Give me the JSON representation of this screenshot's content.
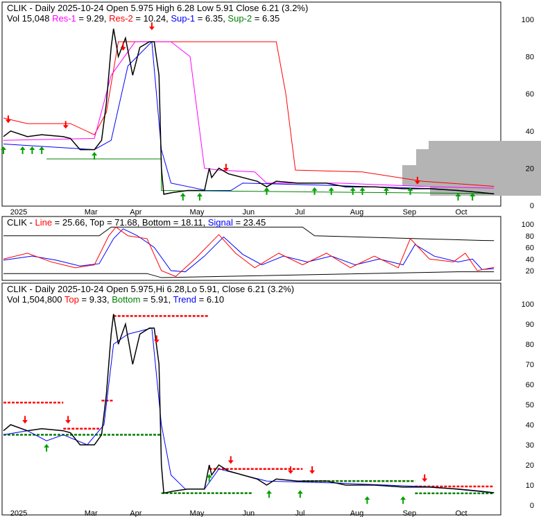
{
  "colors": {
    "res1": "#ff00ff",
    "res2": "#ff0000",
    "sup1": "#0000ff",
    "sup2": "#008000",
    "up": "#00a000",
    "down": "#ff0000"
  },
  "top_header": {
    "line1": "CLIK - Daily 2025-10-24 Open 5.975  High 6.28  Low 5.91  Close 6.21 (3.2%)",
    "vol": "Vol 15,048",
    "res1_label": "Res-1",
    "res1_val": " = 9.29, ",
    "res2_label": "Res-2",
    "res2_val": " = 10.24, ",
    "sup1_label": "Sup-1",
    "sup1_val": " = 6.35, ",
    "sup2_label": "Sup-2",
    "sup2_val": " = 6.35"
  },
  "mid_header": {
    "prefix": "CLIK - ",
    "line_label": "Line",
    "line_val": " = 25.66, Top = 71.68, Bottom = 18.11, ",
    "signal_label": "Signal",
    "signal_val": " = 23.45"
  },
  "bot_header": {
    "line1": "CLIK - Daily 2025-10-24 Open 5.975,Hi 6.28,Lo 5.91, Close 6.21 (3.2%)",
    "vol": "Vol 1,504,800 ",
    "top_label": "Top",
    "top_val": " = 9.33, ",
    "bottom_label": "Bottom",
    "bottom_val": " = 5.91, ",
    "trend_label": "Trend",
    "trend_val": " = 6.10"
  },
  "chart_data": [
    {
      "type": "line",
      "title": "CLIK - Daily price with support/resistance",
      "ylim": [
        0,
        100
      ],
      "yticks": [
        0,
        20,
        40,
        60,
        80,
        100
      ],
      "x_ticks": [
        {
          "label": "2025",
          "day": 4
        },
        {
          "label": "Mar",
          "day": 35
        },
        {
          "label": "Apr",
          "day": 54
        },
        {
          "label": "May",
          "day": 79
        },
        {
          "label": "Jun",
          "day": 101
        },
        {
          "label": "Jul",
          "day": 123
        },
        {
          "label": "Aug",
          "day": 146
        },
        {
          "label": "Sep",
          "day": 168
        },
        {
          "label": "Oct",
          "day": 190
        }
      ],
      "price": [
        [
          0,
          37
        ],
        [
          3,
          40
        ],
        [
          10,
          37
        ],
        [
          16,
          38
        ],
        [
          25,
          37
        ],
        [
          28,
          36
        ],
        [
          32,
          30
        ],
        [
          38,
          30
        ],
        [
          41,
          35
        ],
        [
          43,
          55
        ],
        [
          45,
          85
        ],
        [
          46,
          95
        ],
        [
          48,
          80
        ],
        [
          51,
          90
        ],
        [
          54,
          70
        ],
        [
          57,
          85
        ],
        [
          61,
          88
        ],
        [
          63,
          88
        ],
        [
          65,
          70
        ],
        [
          66,
          20
        ],
        [
          67,
          6
        ],
        [
          71,
          7
        ],
        [
          77,
          8
        ],
        [
          84,
          8
        ],
        [
          86,
          20
        ],
        [
          87,
          15
        ],
        [
          90,
          20
        ],
        [
          94,
          17
        ],
        [
          100,
          15
        ],
        [
          106,
          13
        ],
        [
          110,
          10
        ],
        [
          114,
          13
        ],
        [
          123,
          12
        ],
        [
          135,
          12
        ],
        [
          143,
          10
        ],
        [
          155,
          10
        ],
        [
          167,
          9
        ],
        [
          178,
          9
        ],
        [
          190,
          8
        ],
        [
          199,
          7
        ],
        [
          205,
          6.21
        ]
      ],
      "res2": [
        [
          0,
          47
        ],
        [
          10,
          44
        ],
        [
          28,
          44
        ],
        [
          38,
          38
        ],
        [
          43,
          50
        ],
        [
          48,
          88
        ],
        [
          63,
          88
        ],
        [
          66,
          88
        ],
        [
          114,
          88
        ],
        [
          118,
          60
        ],
        [
          122,
          19
        ],
        [
          150,
          18
        ],
        [
          160,
          16
        ],
        [
          175,
          13
        ],
        [
          205,
          10.24
        ]
      ],
      "res1": [
        [
          0,
          35
        ],
        [
          38,
          36
        ],
        [
          45,
          70
        ],
        [
          55,
          88
        ],
        [
          70,
          88
        ],
        [
          78,
          80
        ],
        [
          84,
          20
        ],
        [
          90,
          19
        ],
        [
          105,
          18
        ],
        [
          110,
          12
        ],
        [
          140,
          12
        ],
        [
          180,
          10
        ],
        [
          205,
          9.29
        ]
      ],
      "sup1": [
        [
          0,
          33
        ],
        [
          38,
          30
        ],
        [
          45,
          35
        ],
        [
          52,
          75
        ],
        [
          62,
          88
        ],
        [
          66,
          30
        ],
        [
          70,
          12
        ],
        [
          85,
          8
        ],
        [
          95,
          8
        ],
        [
          100,
          12
        ],
        [
          130,
          11
        ],
        [
          180,
          9
        ],
        [
          205,
          6.35
        ]
      ],
      "sup2": [
        [
          18,
          25
        ],
        [
          66,
          25
        ],
        [
          66,
          8
        ],
        [
          205,
          6.35
        ]
      ],
      "up_arrows": [
        [
          0,
          28
        ],
        [
          8,
          28
        ],
        [
          12,
          28
        ],
        [
          16,
          28
        ],
        [
          38,
          25
        ],
        [
          75,
          3
        ],
        [
          82,
          3
        ],
        [
          110,
          6
        ],
        [
          130,
          6
        ],
        [
          137,
          6
        ],
        [
          146,
          6
        ],
        [
          150,
          6
        ],
        [
          160,
          6
        ],
        [
          170,
          6
        ],
        [
          190,
          3
        ],
        [
          196,
          3
        ]
      ],
      "down_arrows": [
        [
          2,
          48
        ],
        [
          26,
          45
        ],
        [
          50,
          87
        ],
        [
          62,
          98
        ],
        [
          93,
          22
        ],
        [
          173,
          15
        ]
      ]
    },
    {
      "type": "line",
      "title": "CLIK oscillator",
      "ylim": [
        0,
        100
      ],
      "yticks": [
        20,
        40,
        60,
        80,
        100
      ],
      "line": [
        [
          0,
          40
        ],
        [
          10,
          50
        ],
        [
          20,
          35
        ],
        [
          30,
          25
        ],
        [
          38,
          30
        ],
        [
          44,
          80
        ],
        [
          47,
          95
        ],
        [
          52,
          80
        ],
        [
          60,
          75
        ],
        [
          66,
          20
        ],
        [
          72,
          10
        ],
        [
          80,
          40
        ],
        [
          90,
          82
        ],
        [
          97,
          50
        ],
        [
          105,
          25
        ],
        [
          115,
          50
        ],
        [
          125,
          30
        ],
        [
          135,
          50
        ],
        [
          145,
          25
        ],
        [
          155,
          45
        ],
        [
          165,
          25
        ],
        [
          170,
          75
        ],
        [
          178,
          40
        ],
        [
          188,
          35
        ],
        [
          193,
          50
        ],
        [
          198,
          20
        ],
        [
          205,
          25.66
        ]
      ],
      "signal": [
        [
          0,
          38
        ],
        [
          12,
          45
        ],
        [
          22,
          38
        ],
        [
          32,
          28
        ],
        [
          40,
          32
        ],
        [
          46,
          75
        ],
        [
          50,
          92
        ],
        [
          56,
          80
        ],
        [
          63,
          60
        ],
        [
          70,
          20
        ],
        [
          76,
          18
        ],
        [
          84,
          45
        ],
        [
          92,
          78
        ],
        [
          100,
          48
        ],
        [
          108,
          30
        ],
        [
          117,
          45
        ],
        [
          127,
          35
        ],
        [
          137,
          45
        ],
        [
          147,
          30
        ],
        [
          157,
          40
        ],
        [
          167,
          30
        ],
        [
          172,
          65
        ],
        [
          180,
          45
        ],
        [
          190,
          35
        ],
        [
          196,
          40
        ],
        [
          200,
          22
        ],
        [
          205,
          23.45
        ]
      ],
      "top": [
        [
          0,
          80
        ],
        [
          40,
          80
        ],
        [
          45,
          95
        ],
        [
          125,
          95
        ],
        [
          130,
          80
        ],
        [
          200,
          72
        ],
        [
          205,
          71.68
        ]
      ],
      "bottom": [
        [
          0,
          15
        ],
        [
          60,
          15
        ],
        [
          66,
          8
        ],
        [
          190,
          18
        ],
        [
          205,
          18.11
        ]
      ]
    },
    {
      "type": "line",
      "title": "CLIK - Daily price with trend",
      "ylim": [
        0,
        100
      ],
      "yticks": [
        0,
        10,
        20,
        30,
        40,
        50,
        60,
        70,
        80,
        90,
        100
      ],
      "price": [
        [
          0,
          37
        ],
        [
          3,
          40
        ],
        [
          10,
          37
        ],
        [
          16,
          38
        ],
        [
          25,
          37
        ],
        [
          28,
          36
        ],
        [
          32,
          30
        ],
        [
          38,
          30
        ],
        [
          41,
          35
        ],
        [
          43,
          55
        ],
        [
          45,
          85
        ],
        [
          46,
          95
        ],
        [
          48,
          80
        ],
        [
          51,
          90
        ],
        [
          54,
          70
        ],
        [
          57,
          85
        ],
        [
          61,
          88
        ],
        [
          63,
          88
        ],
        [
          65,
          70
        ],
        [
          66,
          20
        ],
        [
          67,
          6
        ],
        [
          71,
          7
        ],
        [
          77,
          8
        ],
        [
          84,
          8
        ],
        [
          86,
          20
        ],
        [
          87,
          15
        ],
        [
          90,
          20
        ],
        [
          94,
          17
        ],
        [
          100,
          15
        ],
        [
          106,
          13
        ],
        [
          110,
          10
        ],
        [
          114,
          13
        ],
        [
          123,
          12
        ],
        [
          135,
          12
        ],
        [
          143,
          10
        ],
        [
          155,
          10
        ],
        [
          167,
          9
        ],
        [
          178,
          9
        ],
        [
          190,
          8
        ],
        [
          199,
          7
        ],
        [
          205,
          6.21
        ]
      ],
      "trend": [
        [
          0,
          35
        ],
        [
          10,
          37
        ],
        [
          18,
          32
        ],
        [
          25,
          35
        ],
        [
          35,
          30
        ],
        [
          42,
          40
        ],
        [
          46,
          80
        ],
        [
          52,
          85
        ],
        [
          62,
          88
        ],
        [
          66,
          40
        ],
        [
          70,
          15
        ],
        [
          76,
          8
        ],
        [
          84,
          8
        ],
        [
          90,
          18
        ],
        [
          100,
          15
        ],
        [
          110,
          12
        ],
        [
          140,
          11
        ],
        [
          180,
          9
        ],
        [
          205,
          6.1
        ]
      ],
      "top_segments": [
        [
          0,
          25,
          51
        ],
        [
          25,
          40,
          38
        ],
        [
          41,
          46,
          52
        ],
        [
          46,
          86,
          94
        ],
        [
          86,
          125,
          18
        ],
        [
          125,
          172,
          12
        ],
        [
          172,
          205,
          9.33
        ]
      ],
      "bottom_segments": [
        [
          0,
          66,
          35
        ],
        [
          66,
          104,
          6
        ],
        [
          125,
          172,
          12
        ],
        [
          172,
          205,
          5.91
        ]
      ],
      "up_arrows": [
        [
          18,
          27
        ],
        [
          86,
          12
        ],
        [
          111,
          4
        ],
        [
          124,
          4
        ],
        [
          152,
          1
        ],
        [
          167,
          1
        ]
      ],
      "down_arrows": [
        [
          9,
          44
        ],
        [
          27,
          44
        ],
        [
          64,
          84
        ],
        [
          95,
          24
        ],
        [
          120,
          19
        ],
        [
          129,
          19
        ],
        [
          176,
          15
        ]
      ]
    }
  ]
}
